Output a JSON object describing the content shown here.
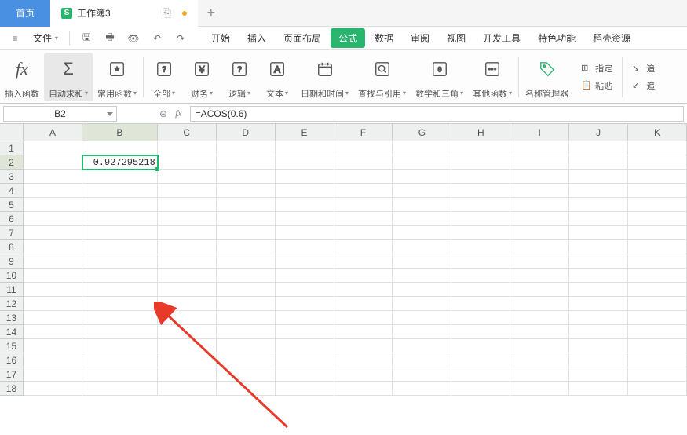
{
  "tabs": {
    "home": "首页",
    "workbook": "工作簿3"
  },
  "file_menu": "文件",
  "menu": {
    "start": "开始",
    "insert": "插入",
    "layout": "页面布局",
    "formula": "公式",
    "data": "数据",
    "review": "审阅",
    "view": "视图",
    "dev": "开发工具",
    "feature": "特色功能",
    "rice": "稻壳资源"
  },
  "ribbon": {
    "insert_fn": "插入函数",
    "autosum": "自动求和",
    "common": "常用函数",
    "all": "全部",
    "finance": "财务",
    "logic": "逻辑",
    "text": "文本",
    "datetime": "日期和时间",
    "lookup": "查找与引用",
    "math": "数学和三角",
    "other": "其他函数",
    "name_mgr": "名称管理器",
    "paste": "粘贴",
    "assign": "指定",
    "trace": "追"
  },
  "name_box": "B2",
  "formula": "=ACOS(0.6)",
  "cols": [
    "A",
    "B",
    "C",
    "D",
    "E",
    "F",
    "G",
    "H",
    "I",
    "J",
    "K"
  ],
  "rows": [
    "1",
    "2",
    "3",
    "4",
    "5",
    "6",
    "7",
    "8",
    "9",
    "10",
    "11",
    "12",
    "13",
    "14",
    "15",
    "16",
    "17",
    "18"
  ],
  "cell_value": "0.927295218"
}
